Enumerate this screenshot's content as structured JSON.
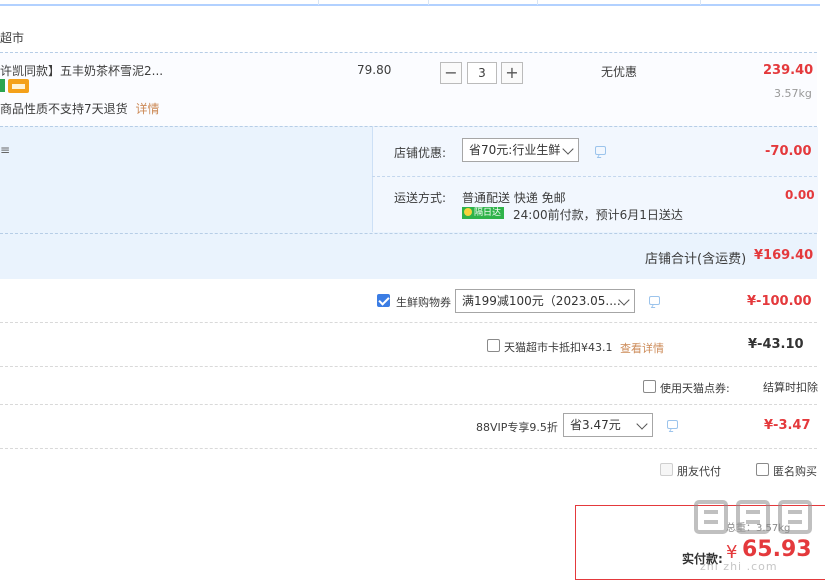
{
  "shop": {
    "name": "超市"
  },
  "item": {
    "title": "许凯同款】五丰奶茶杯雪泥2...",
    "notice": "商品性质不支持7天退货",
    "details_link": "详情",
    "unit_price": "79.80",
    "quantity": "3",
    "promo": "无优惠",
    "subtotal": "239.40",
    "weight": "3.57kg",
    "minus": "−",
    "plus": "+"
  },
  "blue_left_fragment": "≡",
  "store_discount": {
    "label": "店铺优惠:",
    "selected": "省70元:行业生鲜",
    "amount": "-70.00"
  },
  "shipping": {
    "label": "运送方式:",
    "method": "普通配送 快递 免邮",
    "badge": "隔日达",
    "eta": "24:00前付款，预计6月1日送达",
    "fee": "0.00"
  },
  "store_total": {
    "label": "店铺合计(含运费)",
    "amount": "¥169.40"
  },
  "coupon": {
    "label": "生鲜购物券",
    "selected": "满199减100元（2023.05....",
    "amount": "¥-100.00"
  },
  "card_deduct": {
    "label": "天猫超市卡抵扣¥43.1",
    "link": "查看详情",
    "amount": "¥-43.10"
  },
  "points": {
    "label": "使用天猫点券:",
    "note": "结算时扣除"
  },
  "vip": {
    "label": "88VIP专享9.5折",
    "selected": "省3.47元",
    "amount": "¥-3.47"
  },
  "options": {
    "friend_pay": "朋友代付",
    "anonymous": "匿名购买"
  },
  "total": {
    "weight_note": "总重：3.57kg",
    "label": "实付款:",
    "currency": "¥",
    "amount": "65.93"
  },
  "watermark": {
    "text": "zhi zhi .com"
  },
  "colors": {
    "accent_red": "#e4393c",
    "border_blue": "#b2d1ff",
    "panel_blue": "#eaf3fd",
    "link_brown": "#cc8a57"
  }
}
